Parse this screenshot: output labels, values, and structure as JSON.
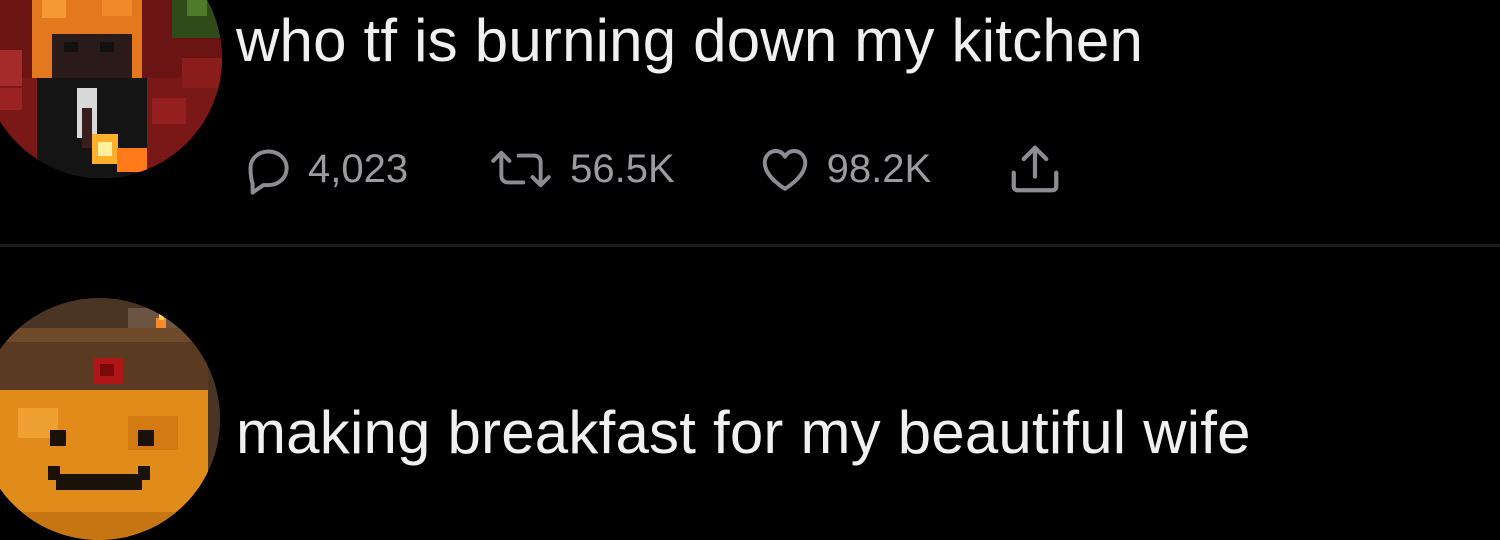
{
  "posts": [
    {
      "text": "who tf is burning down my kitchen",
      "stats": {
        "replies": "4,023",
        "retweets": "56.5K",
        "likes": "98.2K"
      },
      "icons": {
        "reply": "speech-bubble-icon",
        "retweet": "retweet-arrows-icon",
        "like": "heart-icon",
        "share": "share-upload-icon"
      }
    },
    {
      "text": "making breakfast for my beautiful wife"
    }
  ],
  "colors": {
    "background": "#000000",
    "text": "#f0f0f0",
    "muted": "#8b8d91",
    "divider": "#1c1c1e"
  }
}
